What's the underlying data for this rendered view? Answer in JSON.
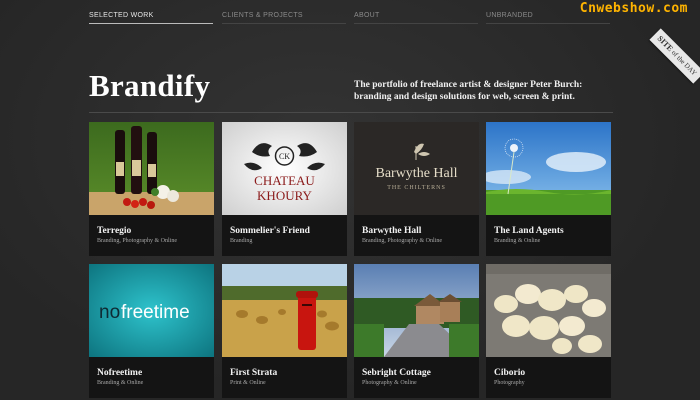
{
  "nav": {
    "items": [
      {
        "label": "SELECTED WORK",
        "active": true
      },
      {
        "label": "CLIENTS & PROJECTS",
        "active": false
      },
      {
        "label": "ABOUT",
        "active": false
      },
      {
        "label": "UNBRANDED",
        "active": false
      }
    ]
  },
  "watermark": "Cnwebshow.com",
  "badge": {
    "site": "SITE",
    "of": "of",
    "day": "the DAY"
  },
  "header": {
    "title": "Brandify",
    "tagline": "The portfolio of freelance artist & designer Peter Burch: branding and design solutions for web, screen & print."
  },
  "portfolio": [
    {
      "title": "Terregio",
      "category": "Branding, Photography & Online"
    },
    {
      "title": "Sommelier's Friend",
      "category": "Branding"
    },
    {
      "title": "Barwythe Hall",
      "category": "Branding, Photography & Online"
    },
    {
      "title": "The Land Agents",
      "category": "Branding & Online"
    },
    {
      "title": "Nofreetime",
      "category": "Branding & Online"
    },
    {
      "title": "First Strata",
      "category": "Print & Online"
    },
    {
      "title": "Sebright Cottage",
      "category": "Photography & Online"
    },
    {
      "title": "Ciborio",
      "category": "Photography"
    }
  ],
  "thumbs": {
    "chateau_line1": "CHATEAU",
    "chateau_line2": "KHOURY",
    "chateau_mono": "CK",
    "barwythe_name": "Barwythe Hall",
    "barwythe_sub": "THE CHILTERNS",
    "nofreetime_a": "no",
    "nofreetime_b": "freetime"
  }
}
